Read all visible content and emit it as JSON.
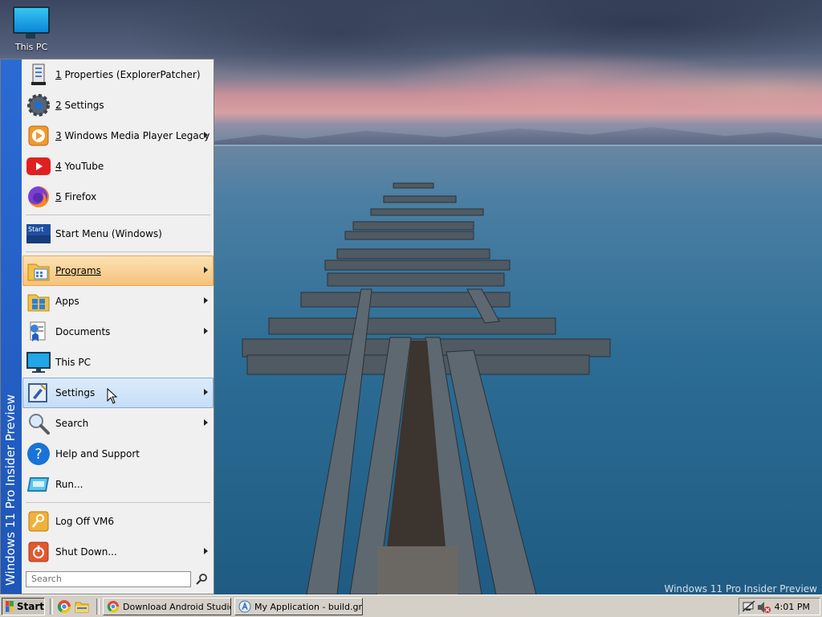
{
  "desktop": {
    "icons": [
      {
        "label": "This PC",
        "icon": "this-pc-icon"
      }
    ],
    "watermark": "Windows 11 Pro Insider Preview"
  },
  "start_menu": {
    "banner": "Windows 11 Pro Insider Preview",
    "recent": [
      {
        "num": "1",
        "label": " Properties (ExplorerPatcher)",
        "icon": "properties-icon",
        "submenu": false
      },
      {
        "num": "2",
        "label": " Settings",
        "icon": "settings-gear-icon",
        "submenu": false
      },
      {
        "num": "3",
        "label": " Windows Media Player Legacy",
        "icon": "media-player-icon",
        "submenu": true
      },
      {
        "num": "4",
        "label": " YouTube",
        "icon": "youtube-icon",
        "submenu": false
      },
      {
        "num": "5",
        "label": " Firefox",
        "icon": "firefox-icon",
        "submenu": false
      }
    ],
    "pinned": {
      "label": "Start Menu (Windows)",
      "icon": "start-menu-tile-icon",
      "icon_text": "Start"
    },
    "main": [
      {
        "label": "Programs",
        "icon": "programs-icon",
        "submenu": true,
        "state": "highlighted"
      },
      {
        "label": "Apps",
        "icon": "apps-icon",
        "submenu": true
      },
      {
        "label": "Documents",
        "icon": "documents-icon",
        "submenu": true
      },
      {
        "label": "This PC",
        "icon": "this-pc-icon",
        "submenu": false
      },
      {
        "label": "Settings",
        "icon": "settings-icon",
        "submenu": true,
        "state": "hover"
      },
      {
        "label": "Search",
        "icon": "search-icon",
        "submenu": true
      },
      {
        "label": "Help and Support",
        "icon": "help-icon",
        "submenu": false
      },
      {
        "label": "Run...",
        "icon": "run-icon",
        "submenu": false
      }
    ],
    "session": [
      {
        "label": "Log Off VM6",
        "icon": "log-off-icon",
        "submenu": false
      },
      {
        "label": "Shut Down...",
        "icon": "shut-down-icon",
        "submenu": true
      }
    ],
    "search": {
      "placeholder": "Search"
    }
  },
  "taskbar": {
    "start_label": "Start",
    "quick_launch": [
      "chrome-icon",
      "file-explorer-icon"
    ],
    "tasks": [
      {
        "label": "Download Android Studio...",
        "icon": "chrome-icon"
      },
      {
        "label": "My Application - build.grad...",
        "icon": "android-studio-icon"
      }
    ],
    "tray": {
      "icons": [
        "network-disconnected-icon",
        "volume-muted-icon"
      ],
      "clock": "4:01 PM"
    }
  },
  "colors": {
    "banner": "#1e55b8",
    "highlight_orange": "#f6c27b",
    "highlight_blue": "#c7def7",
    "taskbar": "#d4d0c8"
  }
}
